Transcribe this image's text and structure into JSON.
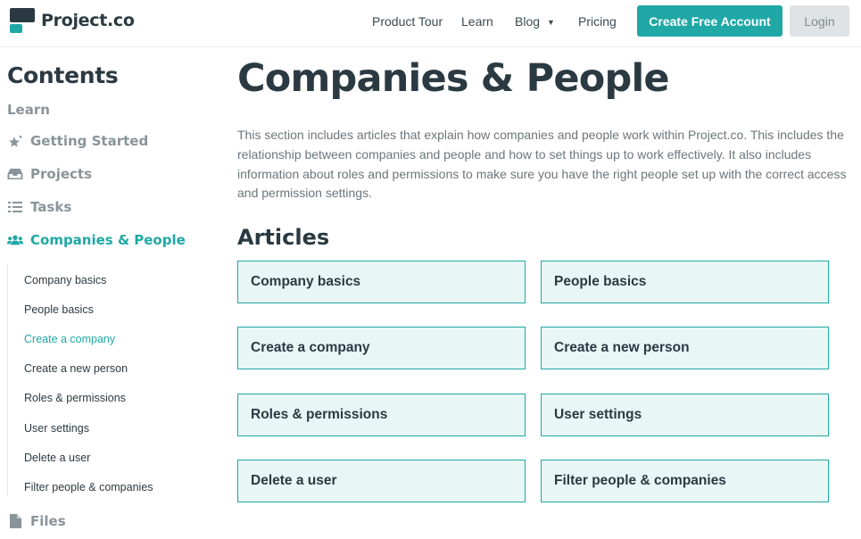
{
  "header": {
    "logo_text": "Project.co",
    "nav": {
      "product_tour": "Product Tour",
      "learn": "Learn",
      "blog": "Blog",
      "pricing": "Pricing"
    },
    "cta_label": "Create Free Account",
    "login_label": "Login"
  },
  "sidebar": {
    "title": "Contents",
    "section_label": "Learn",
    "categories": [
      {
        "label": "Getting Started",
        "icon": "sparkle-star-icon"
      },
      {
        "label": "Projects",
        "icon": "inbox-tray-icon"
      },
      {
        "label": "Tasks",
        "icon": "checklist-icon"
      },
      {
        "label": "Companies & People",
        "icon": "people-group-icon",
        "active": true
      },
      {
        "label": "Files",
        "icon": "file-icon"
      }
    ],
    "sub_items": [
      "Company basics",
      "People basics",
      "Create a company",
      "Create a new person",
      "Roles & permissions",
      "User settings",
      "Delete a user",
      "Filter people & companies"
    ],
    "active_sub_item": "Create a company"
  },
  "main": {
    "title": "Companies & People",
    "intro": "This section includes articles that explain how companies and people work within Project.co. This includes the relationship between companies and people and how to set things up to work effectively. It also includes information about roles and permissions to make sure you have the right people set up with the correct access and permission settings.",
    "articles_heading": "Articles",
    "articles": [
      "Company basics",
      "People basics",
      "Create a company",
      "Create a new person",
      "Roles & permissions",
      "User settings",
      "Delete a user",
      "Filter people & companies"
    ]
  },
  "colors": {
    "accent": "#1fa8a6",
    "dark": "#2b3a42",
    "muted": "#8a9499",
    "card_bg": "#e9f6f6"
  }
}
